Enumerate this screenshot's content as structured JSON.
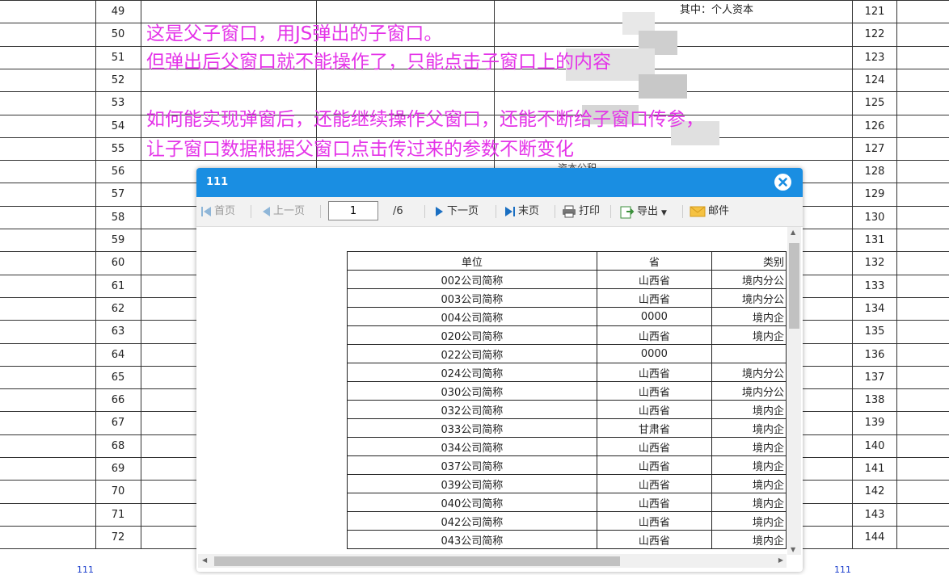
{
  "background": {
    "left_row_numbers": [
      "49",
      "50",
      "51",
      "52",
      "53",
      "54",
      "55",
      "56",
      "57",
      "58",
      "59",
      "60",
      "61",
      "62",
      "63",
      "64",
      "65",
      "66",
      "67",
      "68",
      "69",
      "70",
      "71",
      "72"
    ],
    "right_row_numbers": [
      "121",
      "122",
      "123",
      "124",
      "125",
      "126",
      "127",
      "128",
      "129",
      "130",
      "131",
      "132",
      "133",
      "134",
      "135",
      "136",
      "137",
      "138",
      "139",
      "140",
      "141",
      "142",
      "143",
      "144"
    ],
    "top_note": "其中：个人资本",
    "partial_note": "资本公积",
    "footer_left": "111",
    "footer_right": "111"
  },
  "annotation": {
    "line1": "这是父子窗口，用JS弹出的子窗口。",
    "line2": "但弹出后父窗口就不能操作了，只能点击子窗口上的内容",
    "line3": "如何能实现弹窗后，还能继续操作父窗口，还能不断给子窗口传参，",
    "line4": "让子窗口数据根据父窗口点击传过来的参数不断变化",
    "color": "#e433e8"
  },
  "dialog": {
    "title": "111",
    "title_bar_color": "#1a8ee2",
    "toolbar": {
      "first": "首页",
      "prev": "上一页",
      "page_value": "1",
      "page_total": "/6",
      "next": "下一页",
      "last": "末页",
      "print": "打印",
      "export": "导出",
      "mail": "邮件"
    },
    "table": {
      "headers": [
        "单位",
        "省",
        "类别"
      ],
      "rows": [
        [
          "002公司简称",
          "山西省",
          "境内分公"
        ],
        [
          "003公司简称",
          "山西省",
          "境内分公"
        ],
        [
          "004公司简称",
          "0000",
          "境内企"
        ],
        [
          "020公司简称",
          "山西省",
          "境内企"
        ],
        [
          "022公司简称",
          "0000",
          ""
        ],
        [
          "024公司简称",
          "山西省",
          "境内分公"
        ],
        [
          "030公司简称",
          "山西省",
          "境内分公"
        ],
        [
          "032公司简称",
          "山西省",
          "境内企"
        ],
        [
          "033公司简称",
          "甘肃省",
          "境内企"
        ],
        [
          "034公司简称",
          "山西省",
          "境内企"
        ],
        [
          "037公司简称",
          "山西省",
          "境内企"
        ],
        [
          "039公司简称",
          "山西省",
          "境内企"
        ],
        [
          "040公司简称",
          "山西省",
          "境内企"
        ],
        [
          "042公司简称",
          "山西省",
          "境内企"
        ],
        [
          "043公司简称",
          "山西省",
          "境内企"
        ]
      ]
    }
  }
}
